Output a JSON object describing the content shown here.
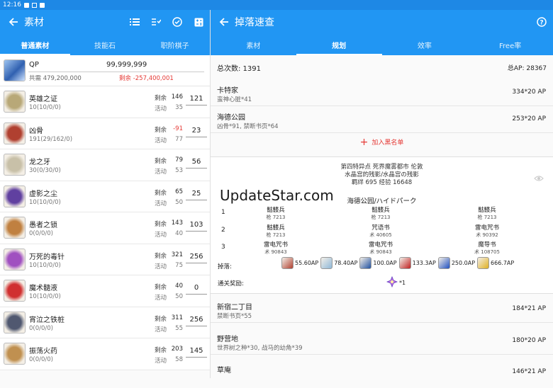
{
  "status": {
    "time": "12:16"
  },
  "left": {
    "title": "素材",
    "tabs": [
      "普通素材",
      "技能石",
      "职阶棋子"
    ],
    "qp": {
      "name": "QP",
      "amount": "99,999,999",
      "need": "共需 479,200,000",
      "remain": "剩余 -257,400,001"
    },
    "labels": {
      "remain": "剩余",
      "event": "活动"
    },
    "items": [
      {
        "name": "英雄之证",
        "count": "10(10/0/0)",
        "remain": "146",
        "event": "35",
        "plan": "121",
        "remain_red": false,
        "color": "#b8a878"
      },
      {
        "name": "凶骨",
        "count": "191(29/162/0)",
        "remain": "-91",
        "event": "77",
        "plan": "23",
        "remain_red": true,
        "color": "#b04030"
      },
      {
        "name": "龙之牙",
        "count": "30(0/30/0)",
        "remain": "79",
        "event": "53",
        "plan": "56",
        "remain_red": false,
        "color": "#c8c0a8"
      },
      {
        "name": "虚影之尘",
        "count": "10(10/0/0)",
        "remain": "65",
        "event": "50",
        "plan": "25",
        "remain_red": false,
        "color": "#6040a0"
      },
      {
        "name": "愚者之锁",
        "count": "0(0/0/0)",
        "remain": "143",
        "event": "40",
        "plan": "103",
        "remain_red": false,
        "color": "#c08040"
      },
      {
        "name": "万死的毒针",
        "count": "10(10/0/0)",
        "remain": "321",
        "event": "75",
        "plan": "256",
        "remain_red": false,
        "color": "#a050c0"
      },
      {
        "name": "魔术髓液",
        "count": "10(10/0/0)",
        "remain": "40",
        "event": "50",
        "plan": "0",
        "remain_red": false,
        "color": "#d03030"
      },
      {
        "name": "宵泣之铁桩",
        "count": "0(0/0/0)",
        "remain": "311",
        "event": "55",
        "plan": "256",
        "remain_red": false,
        "color": "#505870"
      },
      {
        "name": "振荡火药",
        "count": "0(0/0/0)",
        "remain": "203",
        "event": "58",
        "plan": "145",
        "remain_red": false,
        "color": "#c09050"
      }
    ]
  },
  "right": {
    "title": "掉落速查",
    "tabs": [
      "素材",
      "规划",
      "效率",
      "Free率"
    ],
    "total": {
      "count": "总次数: 1391",
      "ap": "总AP: 28367"
    },
    "quests_top": [
      {
        "name": "卡特家",
        "drop": "蛮神心脏*41",
        "ap": "334*20 AP"
      },
      {
        "name": "海德公园",
        "drop": "凶骨*91, 禁断书页*64",
        "ap": "253*20 AP"
      }
    ],
    "add_blacklist": "加入黑名单",
    "card": {
      "line1": "第四特异点 死界魔雾都市 伦敦",
      "line2": "水晶宫的残影/水晶宫の残影",
      "line3": "羁绊 695  经验 16648",
      "location": "海德公园/ハイドパーク",
      "waves": [
        {
          "num": "1",
          "enemies": [
            {
              "name": "骷髅兵",
              "hp": "枪 7213"
            },
            {
              "name": "骷髅兵",
              "hp": "枪 7213"
            },
            {
              "name": "骷髅兵",
              "hp": "枪 7213"
            }
          ]
        },
        {
          "num": "2",
          "enemies": [
            {
              "name": "骷髅兵",
              "hp": "枪 7213"
            },
            {
              "name": "咒语书",
              "hp": "术 40605"
            },
            {
              "name": "雷电咒书",
              "hp": "术 90392"
            }
          ]
        },
        {
          "num": "3",
          "enemies": [
            {
              "name": "雷电咒书",
              "hp": "术 90843"
            },
            {
              "name": "雷电咒书",
              "hp": "术 90843"
            },
            {
              "name": "魔导书",
              "hp": "术 108705"
            }
          ]
        }
      ],
      "drops_label": "掉落:",
      "drops": [
        {
          "ap": "55.60AP",
          "color": "#b04030"
        },
        {
          "ap": "78.40AP",
          "color": "#8fb8d8"
        },
        {
          "ap": "100.0AP",
          "color": "#2050a0"
        },
        {
          "ap": "133.3AP",
          "color": "#c02020"
        },
        {
          "ap": "250.0AP",
          "color": "#2050c0"
        },
        {
          "ap": "666.7AP",
          "color": "#e0b020"
        }
      ],
      "clear_label": "通关奖励:",
      "clear_reward": "*1"
    },
    "quests_bottom": [
      {
        "name": "新宿二丁目",
        "drop": "禁断书页*55",
        "ap": "184*21 AP"
      },
      {
        "name": "野营地",
        "drop": "世界树之种*30, 战马的幼角*39",
        "ap": "180*20 AP"
      },
      {
        "name": "草庵",
        "drop": "",
        "ap": "146*21 AP"
      }
    ]
  },
  "watermark": "UpdateStar.com"
}
